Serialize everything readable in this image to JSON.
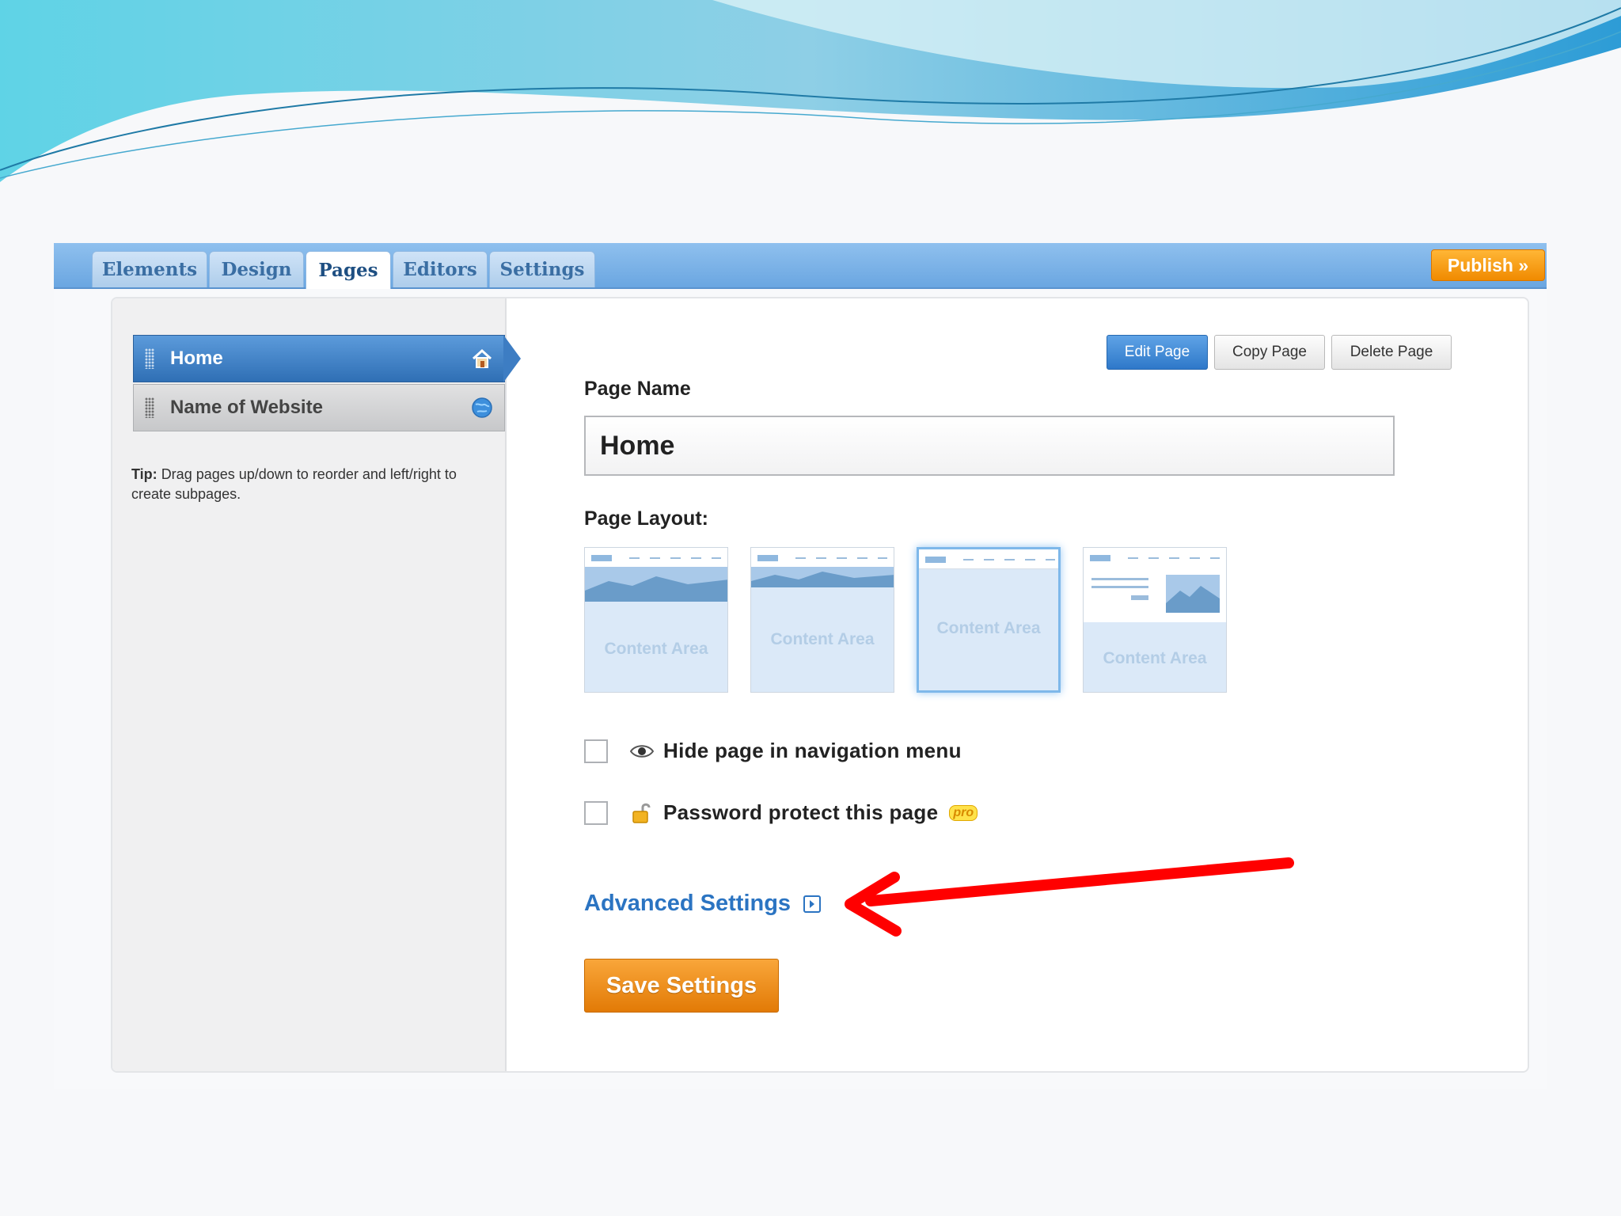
{
  "colors": {
    "tab_bar": "#7ab2e7",
    "selected_page": "#3d7dc3",
    "accent_orange": "#f0900f",
    "link_blue": "#2b74c2",
    "annotation_arrow": "#ff0000"
  },
  "tabs": [
    {
      "label": "Elements",
      "active": false
    },
    {
      "label": "Design",
      "active": false
    },
    {
      "label": "Pages",
      "active": true
    },
    {
      "label": "Editors",
      "active": false
    },
    {
      "label": "Settings",
      "active": false
    }
  ],
  "publish_label": "Publish »",
  "sidebar": {
    "pages": [
      {
        "label": "Home",
        "icon": "home-icon",
        "selected": true
      },
      {
        "label": "Name of Website",
        "icon": "globe-icon",
        "selected": false
      }
    ],
    "tip_label": "Tip:",
    "tip_text": "Drag pages up/down to reorder and left/right to create subpages."
  },
  "actions": {
    "edit": "Edit Page",
    "copy": "Copy Page",
    "delete": "Delete Page"
  },
  "page_name": {
    "label": "Page Name",
    "value": "Home"
  },
  "page_layout": {
    "label": "Page Layout:",
    "options": [
      {
        "text": "Content Area",
        "variant": "tall-banner",
        "selected": false
      },
      {
        "text": "Content Area",
        "variant": "short-banner",
        "selected": false
      },
      {
        "text": "Content Area",
        "variant": "no-banner",
        "selected": true
      },
      {
        "text": "Content Area",
        "variant": "text-and-image",
        "selected": false
      }
    ]
  },
  "options": {
    "hide_nav": {
      "label": "Hide page in navigation menu",
      "checked": false,
      "icon": "eye-icon"
    },
    "password": {
      "label": "Password protect this page",
      "checked": false,
      "icon": "lock-icon",
      "badge": "pro"
    }
  },
  "advanced_settings": "Advanced Settings",
  "save_label": "Save Settings"
}
